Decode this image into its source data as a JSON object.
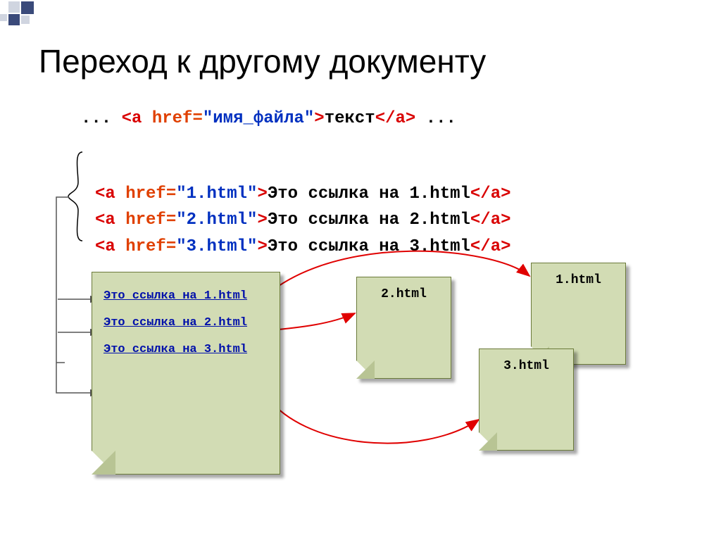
{
  "title": "Переход к другому документу",
  "syntax": {
    "prefix": "... ",
    "open_a": "<a ",
    "href_attr": "href=",
    "filename": "\"имя_файла\"",
    "close_open": ">",
    "text": "текст",
    "close_a": "</a>",
    "suffix": " ..."
  },
  "examples": [
    {
      "file": "\"1.html\"",
      "text": "Это ссылка на 1.html"
    },
    {
      "file": "\"2.html\"",
      "text": "Это ссылка на 2.html"
    },
    {
      "file": "\"3.html\"",
      "text": "Это ссылка на 3.html"
    }
  ],
  "doc_links": [
    "Это ссылка на 1.html",
    "Это ссылка на 2.html",
    "Это ссылка на 3.html"
  ],
  "file_docs": {
    "d1": "1.html",
    "d2": "2.html",
    "d3": "3.html"
  }
}
